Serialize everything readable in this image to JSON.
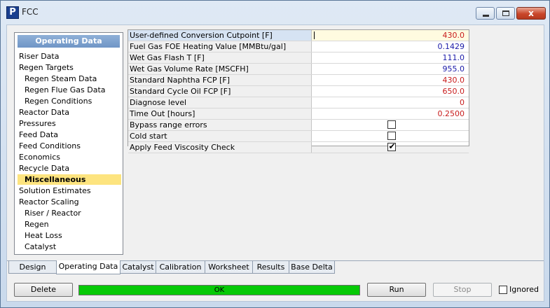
{
  "window": {
    "title": "FCC",
    "app_icon": "P",
    "close_glyph": "x"
  },
  "nav": {
    "header": "Operating Data",
    "items": [
      {
        "label": "Riser Data",
        "level": 0
      },
      {
        "label": "Regen Targets",
        "level": 0
      },
      {
        "label": "Regen Steam Data",
        "level": 1
      },
      {
        "label": "Regen Flue Gas Data",
        "level": 1
      },
      {
        "label": "Regen Conditions",
        "level": 1
      },
      {
        "label": "Reactor Data",
        "level": 0
      },
      {
        "label": "Pressures",
        "level": 0
      },
      {
        "label": "Feed Data",
        "level": 0
      },
      {
        "label": "Feed Conditions",
        "level": 0
      },
      {
        "label": "Economics",
        "level": 0
      },
      {
        "label": "Recycle Data",
        "level": 0
      },
      {
        "label": "Miscellaneous",
        "level": 0,
        "selected": true
      },
      {
        "label": "Solution Estimates",
        "level": 0
      },
      {
        "label": "Reactor Scaling",
        "level": 0
      },
      {
        "label": "Riser / Reactor",
        "level": 1
      },
      {
        "label": "Regen",
        "level": 1
      },
      {
        "label": "Heat Loss",
        "level": 1
      },
      {
        "label": "Catalyst",
        "level": 1
      }
    ]
  },
  "grid": {
    "rows": [
      {
        "label": "User-defined Conversion Cutpoint [F]",
        "value": "430.0",
        "color": "red"
      },
      {
        "label": "Fuel Gas FOE Heating Value [MMBtu/gal]",
        "value": "0.1429",
        "color": "blue"
      },
      {
        "label": "Wet Gas Flash T [F]",
        "value": "111.0",
        "color": "blue"
      },
      {
        "label": "Wet Gas Volume Rate [MSCFH]",
        "value": "955.0",
        "color": "blue"
      },
      {
        "label": "Standard Naphtha FCP [F]",
        "value": "430.0",
        "color": "red"
      },
      {
        "label": "Standard Cycle Oil FCP [F]",
        "value": "650.0",
        "color": "red"
      },
      {
        "label": "Diagnose level",
        "value": "0",
        "color": "red"
      },
      {
        "label": "Time Out [hours]",
        "value": "0.2500",
        "color": "red"
      },
      {
        "label": "Bypass range errors",
        "checkbox": true,
        "checked": false
      },
      {
        "label": "Cold start",
        "checkbox": true,
        "checked": false
      },
      {
        "label": "Apply Feed Viscosity Check",
        "checkbox": true,
        "checked": true
      }
    ]
  },
  "tabs": [
    {
      "label": "Design"
    },
    {
      "label": "Operating Data",
      "active": true
    },
    {
      "label": "Catalyst"
    },
    {
      "label": "Calibration"
    },
    {
      "label": "Worksheet"
    },
    {
      "label": "Results"
    },
    {
      "label": "Base Delta"
    }
  ],
  "footer": {
    "delete_label": "Delete",
    "status_text": "OK",
    "run_label": "Run",
    "stop_label": "Stop",
    "ignored_label": "Ignored",
    "ignored_checked": false
  },
  "colors": {
    "red": "#c81c1c",
    "blue": "#1a1aa8",
    "status_ok": "#06c906",
    "nav_selected": "#fde47f",
    "check_mark": "✔"
  }
}
